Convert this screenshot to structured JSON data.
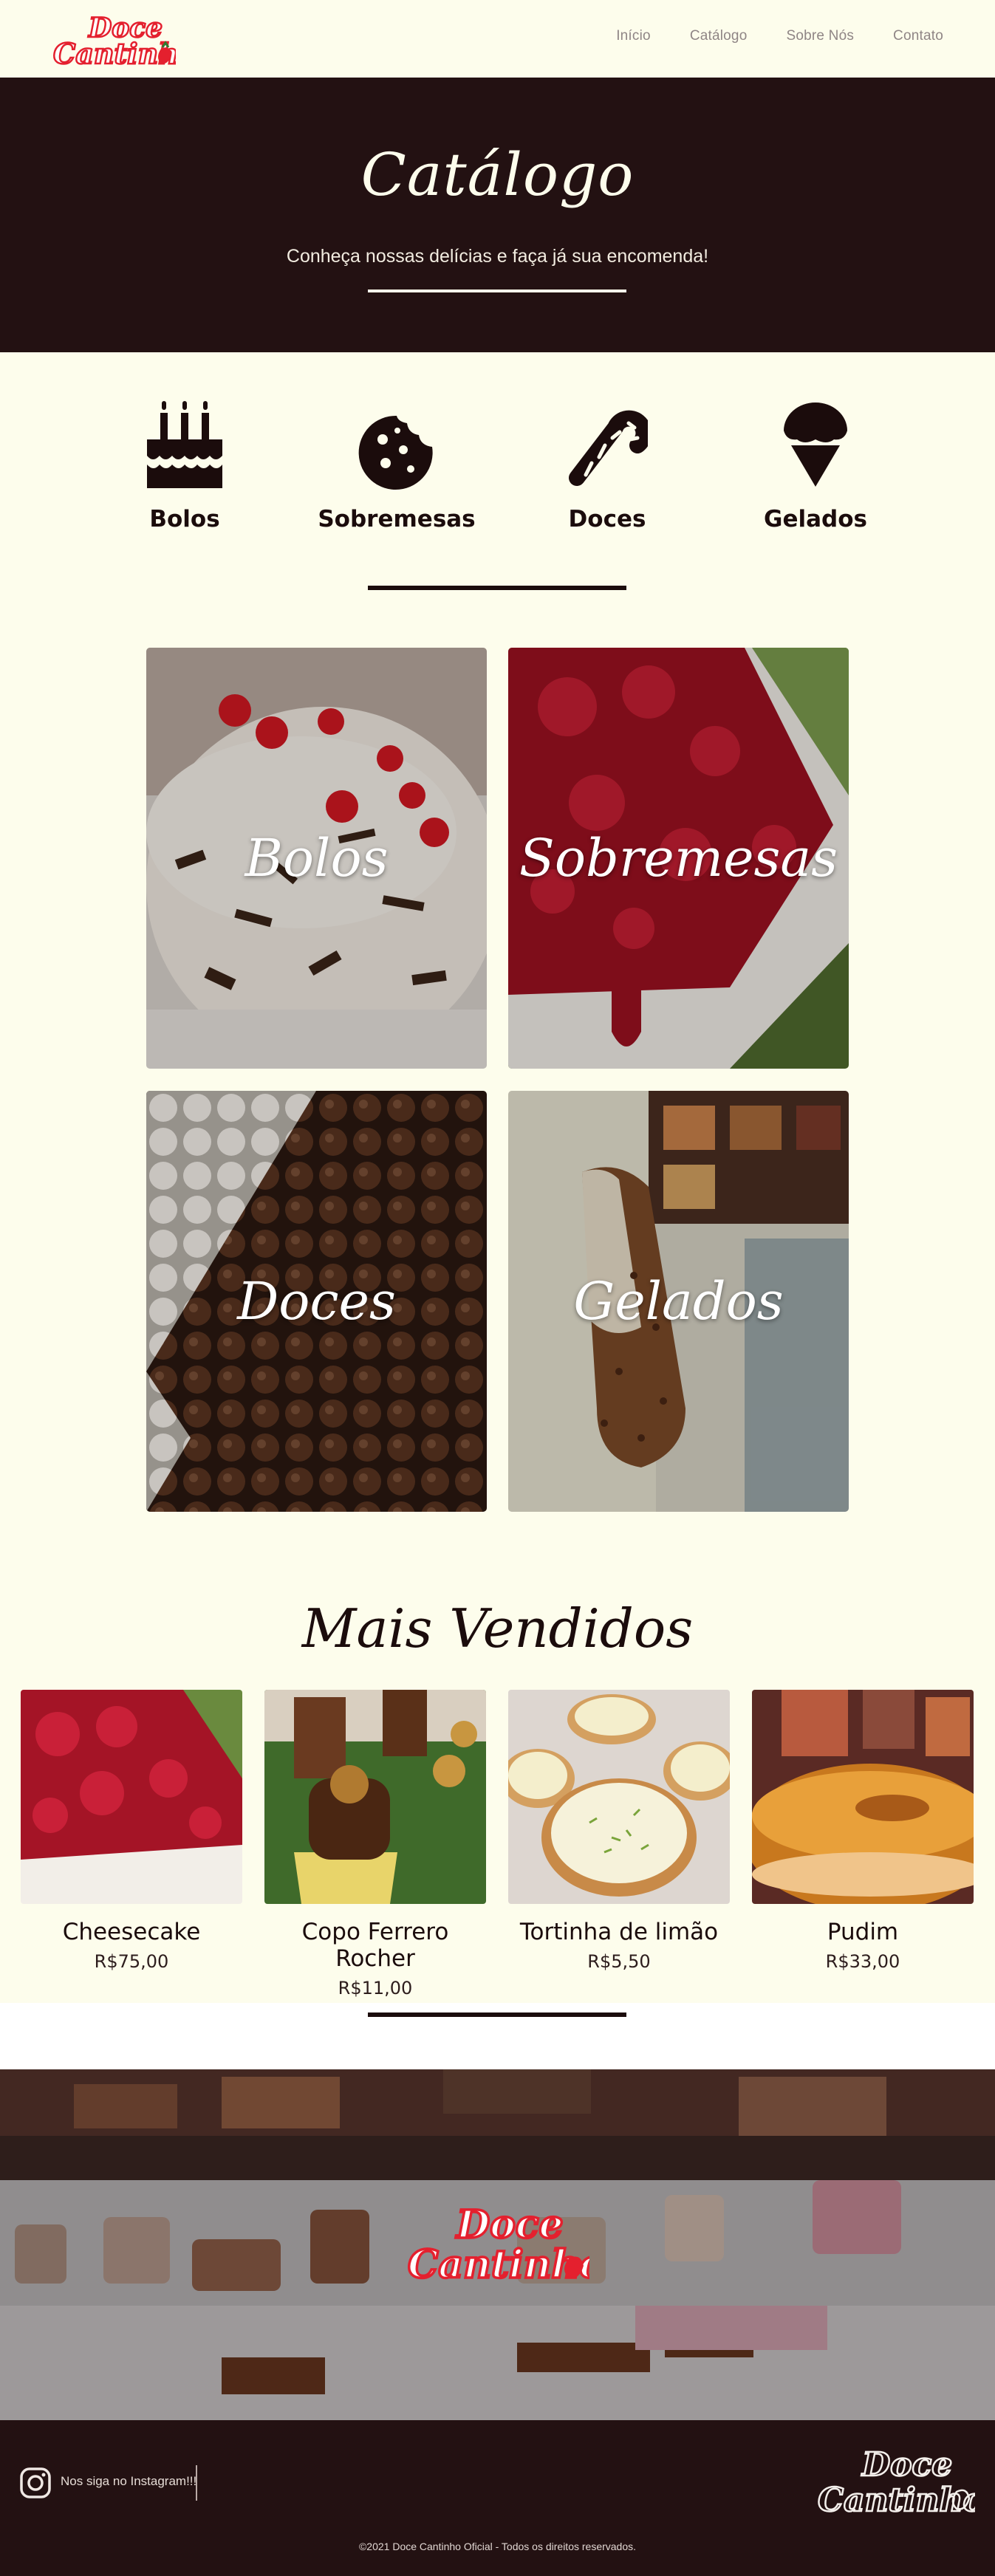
{
  "nav": {
    "logo_text_1": "Doce",
    "logo_text_2": "Cantinho",
    "links": [
      "Início",
      "Catálogo",
      "Sobre Nós",
      "Contato"
    ]
  },
  "hero": {
    "title": "Catálogo",
    "subtitle": "Conheça nossas delícias e faça já sua encomenda!"
  },
  "categories": [
    {
      "label": "Bolos",
      "icon": "cake-icon"
    },
    {
      "label": "Sobremesas",
      "icon": "cookie-icon"
    },
    {
      "label": "Doces",
      "icon": "candy-cane-icon"
    },
    {
      "label": "Gelados",
      "icon": "ice-cream-icon"
    }
  ],
  "cards": [
    "Bolos",
    "Sobremesas",
    "Doces",
    "Gelados"
  ],
  "best_sellers": {
    "title": "Mais Vendidos",
    "products": [
      {
        "name": "Cheesecake",
        "price": "R$75,00"
      },
      {
        "name": "Copo Ferrero Rocher",
        "price": "R$11,00"
      },
      {
        "name": "Tortinha de limão",
        "price": "R$5,50"
      },
      {
        "name": "Pudim",
        "price": "R$33,00"
      }
    ]
  },
  "footer": {
    "instagram": "Nos siga no Instagram!!!",
    "copyright": "©2021 Doce Cantinho Oficial - Todos os direitos reservados."
  },
  "colors": {
    "background": "#fdfdec",
    "dark": "#231112",
    "brand_red": "#e4202e"
  }
}
